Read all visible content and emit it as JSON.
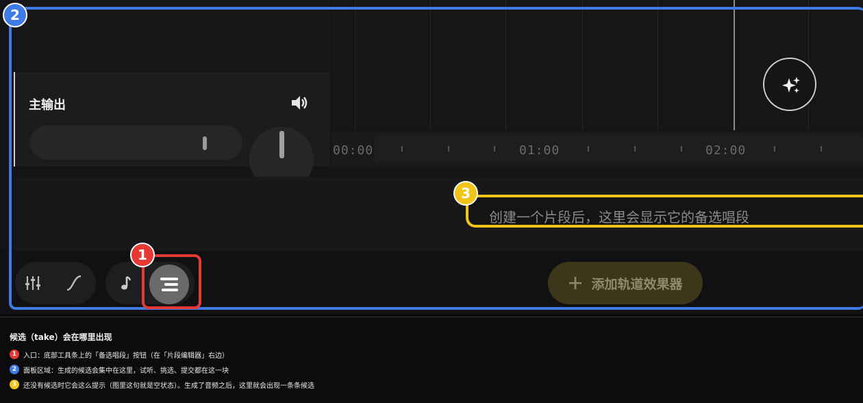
{
  "mixer": {
    "master_label": "主输出",
    "icons": {
      "speaker": "speaker-icon",
      "ai": "sparkles-icon"
    }
  },
  "timeline": {
    "time_labels": [
      "00:00",
      "01:00",
      "02:00"
    ]
  },
  "takes_panel": {
    "empty_hint": "创建一个片段后，这里会显示它的备选唱段"
  },
  "toolbar": {
    "add_effect_label": "添加轨道效果器",
    "buttons": [
      "mixer-sliders-icon",
      "automation-curve-icon",
      "music-note-icon",
      "takes-list-icon"
    ]
  },
  "annotations": {
    "badge_1": "1",
    "badge_2": "2",
    "badge_3": "3",
    "colors": {
      "red": "#e53935",
      "blue": "#3f7be6",
      "yellow": "#f0c419"
    }
  },
  "legend": {
    "title": "候选（take）会在哪里出现",
    "items": [
      {
        "num": "1",
        "text": "入口：底部工具条上的「备选唱段」按钮（在「片段编辑器」右边）"
      },
      {
        "num": "2",
        "text": "面板区域：生成的候选会集中在这里，试听、挑选、提交都在这一块"
      },
      {
        "num": "3",
        "text": "还没有候选时它会这么提示（图里这句就是空状态）。生成了音频之后，这里就会出现一条条候选"
      }
    ]
  }
}
